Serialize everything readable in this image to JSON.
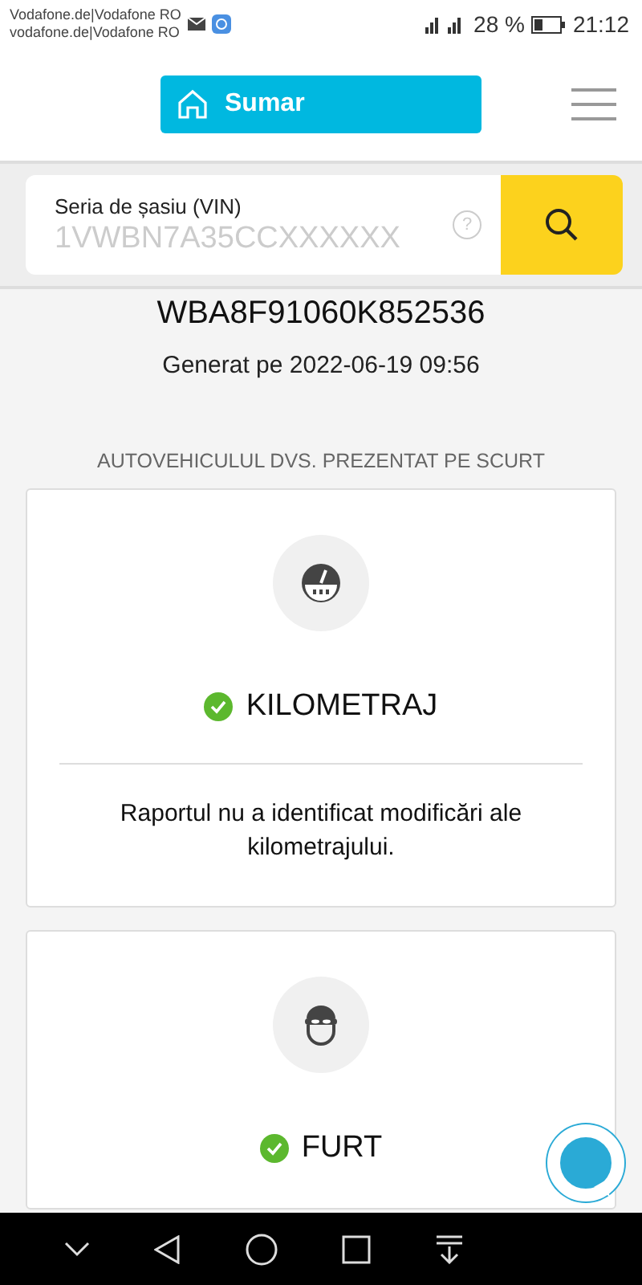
{
  "status_bar": {
    "carriers": [
      "Vodafone.de|Vodafone RO",
      "vodafone.de|Vodafone RO"
    ],
    "battery": "28 %",
    "time": "21:12"
  },
  "header": {
    "summary_button": "Sumar"
  },
  "search": {
    "label": "Seria de șasiu (VIN)",
    "placeholder": "1VWBN7A35CCXXXXXX",
    "help": "?"
  },
  "report": {
    "vin": "WBA8F91060K852536",
    "generated": "Generat pe 2022-06-19 09:56"
  },
  "section_title": "AUTOVEHICULUL DVS. PREZENTAT PE SCURT",
  "cards": [
    {
      "kind": "odometer",
      "title": "KILOMETRAJ",
      "ok": true,
      "text": "Raportul nu a identificat modificări ale kilometrajului."
    },
    {
      "kind": "theft",
      "title": "FURT",
      "ok": true
    }
  ]
}
